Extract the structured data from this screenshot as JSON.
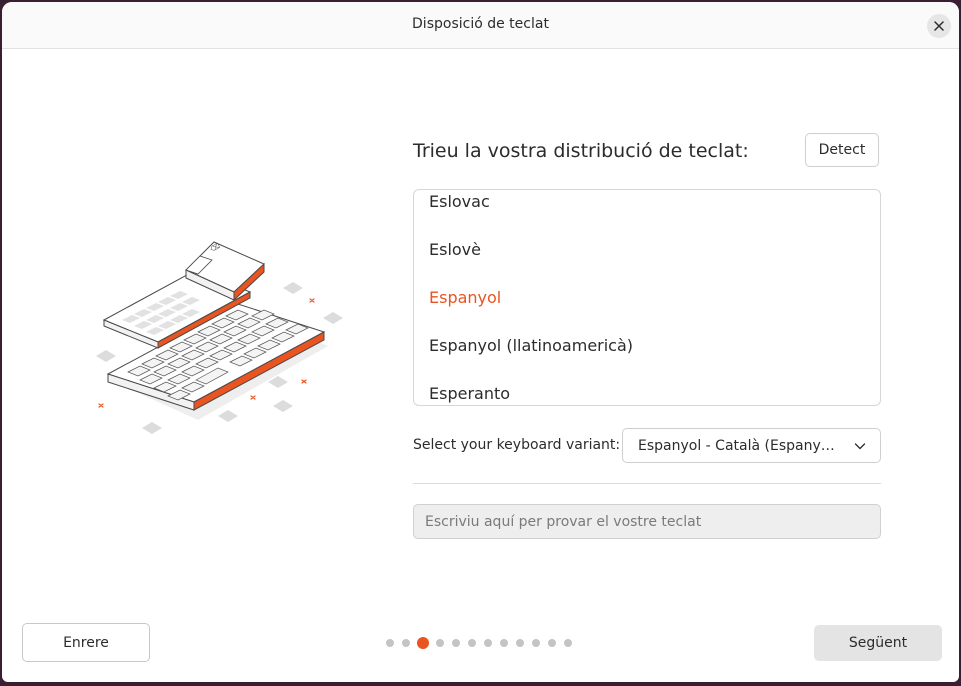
{
  "window": {
    "title": "Disposició de teclat"
  },
  "heading": "Trieu la vostra distribució de teclat:",
  "detect_button": "Detect",
  "layouts": {
    "items": [
      {
        "label": "Eslovac",
        "selected": false
      },
      {
        "label": "Eslovè",
        "selected": false
      },
      {
        "label": "Espanyol",
        "selected": true
      },
      {
        "label": "Espanyol (llatinoamericà)",
        "selected": false
      },
      {
        "label": "Esperanto",
        "selected": false
      }
    ]
  },
  "variant": {
    "label": "Select your keyboard variant:",
    "value": "Espanyol - Català (Espanya, L..."
  },
  "test_input": {
    "placeholder": "Escriviu aquí per provar el vostre teclat",
    "value": ""
  },
  "footer": {
    "back_label": "Enrere",
    "next_label": "Següent",
    "pager": {
      "total": 12,
      "current": 3
    }
  },
  "colors": {
    "accent": "#e95420",
    "background": "#ffffff"
  },
  "icons": {
    "close": "close-icon",
    "chevron": "chevron-down-icon"
  }
}
